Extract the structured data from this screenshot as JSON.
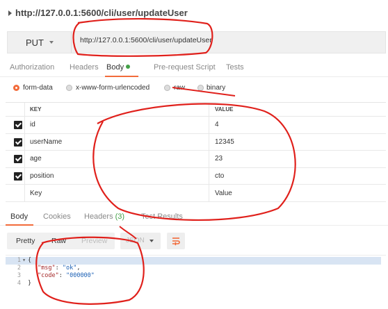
{
  "request": {
    "title": "http://127.0.0.1:5600/cli/user/updateUser",
    "method": "PUT",
    "url": "http://127.0.0.1:5600/cli/user/updateUser"
  },
  "request_tabs": [
    {
      "label": "Authorization"
    },
    {
      "label": "Headers"
    },
    {
      "label": "Body"
    },
    {
      "label": "Pre-request Script"
    },
    {
      "label": "Tests"
    }
  ],
  "body_types": [
    {
      "label": "form-data",
      "selected": true
    },
    {
      "label": "x-www-form-urlencoded",
      "selected": false
    },
    {
      "label": "raw",
      "selected": false
    },
    {
      "label": "binary",
      "selected": false
    }
  ],
  "params": {
    "headers": {
      "key": "KEY",
      "value": "VALUE"
    },
    "rows": [
      {
        "key": "id",
        "value": "4",
        "checked": true
      },
      {
        "key": "userName",
        "value": "12345",
        "checked": true
      },
      {
        "key": "age",
        "value": "23",
        "checked": true
      },
      {
        "key": "position",
        "value": "cto",
        "checked": true
      }
    ],
    "new_row": {
      "key_placeholder": "Key",
      "value_placeholder": "Value"
    }
  },
  "response_tabs": [
    {
      "label": "Body"
    },
    {
      "label": "Cookies"
    },
    {
      "label": "Headers",
      "count": "(3)"
    },
    {
      "label": "Test Results"
    }
  ],
  "response_view": {
    "modes": [
      "Pretty",
      "Raw",
      "Preview"
    ],
    "format": "JSON"
  },
  "response_body": {
    "lines": [
      {
        "n": "1",
        "open": "{"
      },
      {
        "n": "2",
        "key": "\"msg\"",
        "sep": ": ",
        "val": "\"ok\"",
        "end": ","
      },
      {
        "n": "3",
        "key": "\"code\"",
        "sep": ": ",
        "val": "\"000000\"",
        "end": ""
      },
      {
        "n": "4",
        "open": "}"
      }
    ]
  },
  "colors": {
    "accent": "#f26b3a",
    "green": "#43a047",
    "annotation": "#e0201b"
  },
  "icons": [
    "caret-right-icon",
    "caret-down-icon",
    "checkbox-checked-icon",
    "wrap-lines-icon",
    "fold-icon"
  ]
}
